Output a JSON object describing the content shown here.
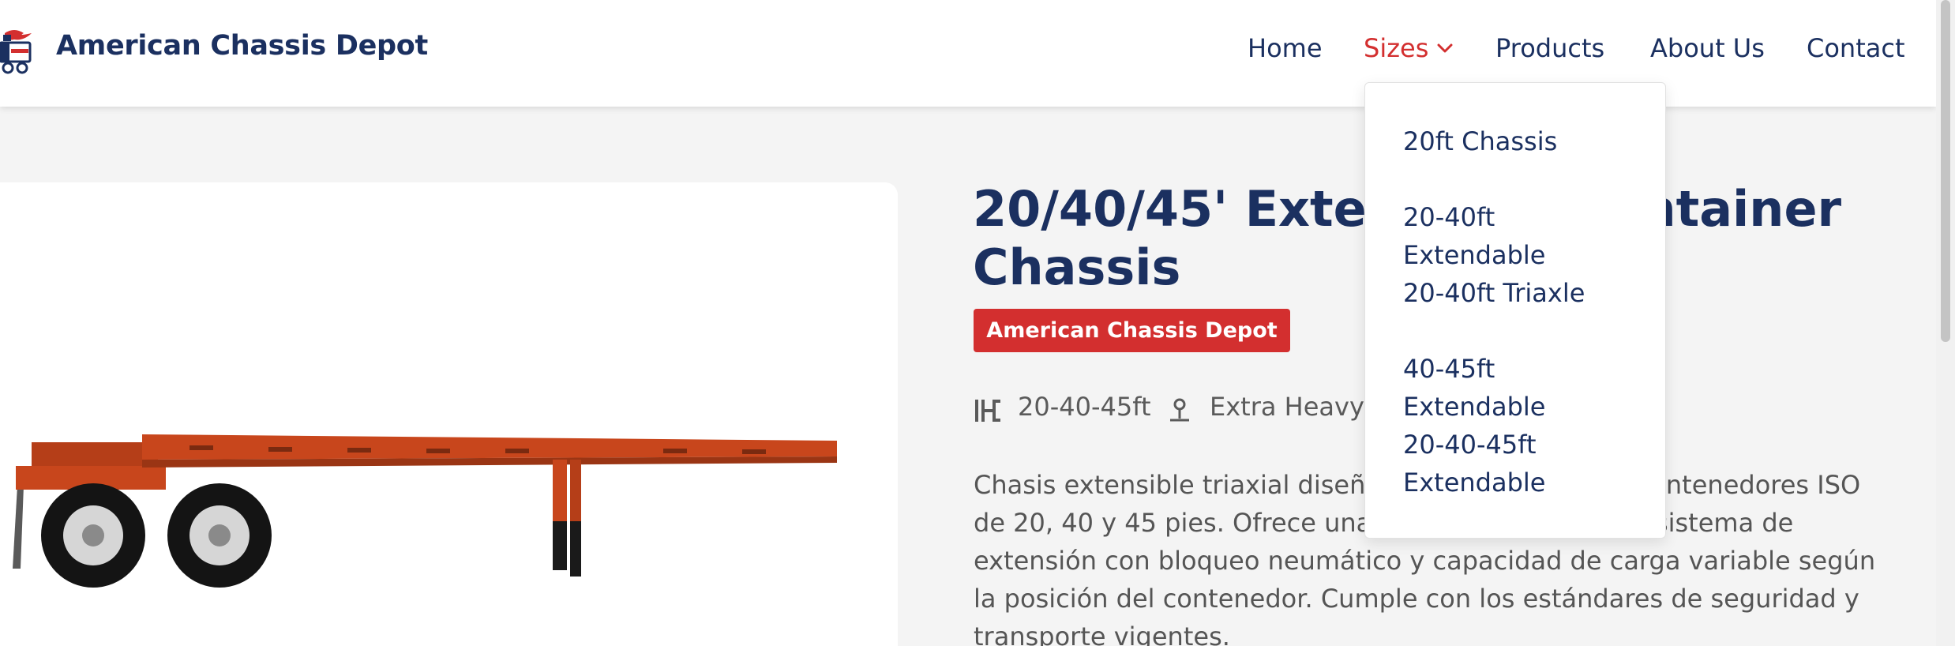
{
  "header": {
    "brand": "American Chassis Depot",
    "logo_icon": "truck-flag-icon",
    "nav": [
      {
        "label": "Home"
      },
      {
        "label": "Sizes",
        "active": true
      },
      {
        "label": "Products"
      },
      {
        "label": "About Us"
      },
      {
        "label": "Contact"
      }
    ]
  },
  "dropdown": {
    "items": [
      "20ft Chassis",
      "20-40ft Extendable",
      "20-40ft Triaxle",
      "40-45ft Extendable",
      "20-40-45ft Extendable"
    ]
  },
  "product": {
    "title": "20/40/45' Extendable Container Chassis",
    "badge": "American Chassis Depot",
    "specs": [
      {
        "icon": "ruler-icon",
        "text": "20-40-45ft"
      },
      {
        "icon": "weight-icon",
        "text": "Extra Heavy Duty"
      }
    ],
    "description": "Chasis extensible triaxial diseñado para transportar contenedores ISO de 20, 40 y 45 pies. Ofrece una estructura reforzada, sistema de extensión con bloqueo neumático y capacidad de carga variable según la posición del contenedor. Cumple con los estándares de seguridad y transporte vigentes."
  },
  "colors": {
    "navy": "#1b3060",
    "accent_red": "#d32f2f",
    "chassis_orange": "#c8461c",
    "page_bg": "#f4f4f4"
  }
}
